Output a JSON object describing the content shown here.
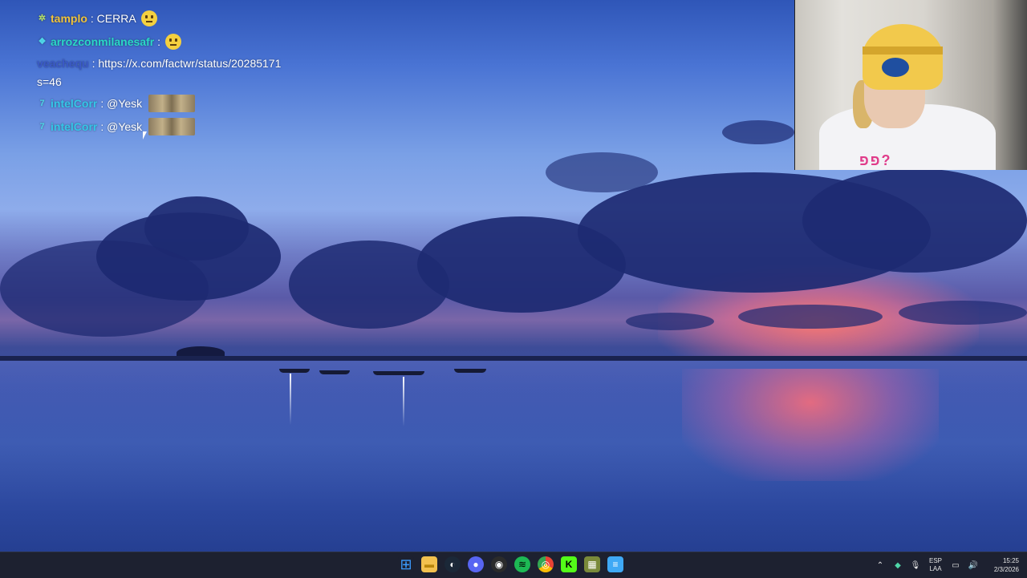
{
  "chat": {
    "messages": [
      {
        "user": "tamplo",
        "badge": "✲",
        "text": ": CERRA",
        "emoji": "neutral"
      },
      {
        "user": "arrozconmilanesafr",
        "badge": "❖",
        "text": ":",
        "emoji": "neutral"
      },
      {
        "user": "veachequ",
        "text": ": https://x.com/factwr/status/20285171"
      },
      {
        "continuation": "s=46"
      },
      {
        "user": "intelCorr",
        "badge": "7",
        "text": ": @Yesk",
        "emoji": "cat-emote"
      },
      {
        "user": "intelCorr",
        "badge": "7",
        "text": ": @Yesk",
        "emoji": "cat-emote"
      }
    ],
    "colors": {
      "tamplo": "#f0c33c",
      "arrozconmilanesafr": "#2ad9c6",
      "veachequ": "#3a59c8",
      "intelCorr": "#34c7e8"
    }
  },
  "webcam": {
    "shirt_print": "פפ?"
  },
  "taskbar": {
    "apps": [
      {
        "name": "start",
        "glyph": "⊞",
        "color": "#3b9cff"
      },
      {
        "name": "file-explorer",
        "glyph": "▬",
        "color": "#f2c14e"
      },
      {
        "name": "steam",
        "glyph": "◐",
        "color": "#2a4a78"
      },
      {
        "name": "discord",
        "glyph": "●",
        "color": "#5865f2"
      },
      {
        "name": "obs",
        "glyph": "◉",
        "color": "#333"
      },
      {
        "name": "spotify",
        "glyph": "≋",
        "color": "#1db954"
      },
      {
        "name": "chrome",
        "glyph": "◎",
        "color": "#e94235"
      },
      {
        "name": "kick",
        "glyph": "K",
        "color": "#53fc18"
      },
      {
        "name": "minecraft",
        "glyph": "▦",
        "color": "#7a8a3a"
      },
      {
        "name": "notepad",
        "glyph": "≡",
        "color": "#3fa9f5"
      }
    ],
    "tray": {
      "language": "ESP",
      "layout": "LAA",
      "time": "15:25",
      "date": "2/3/2026"
    }
  }
}
